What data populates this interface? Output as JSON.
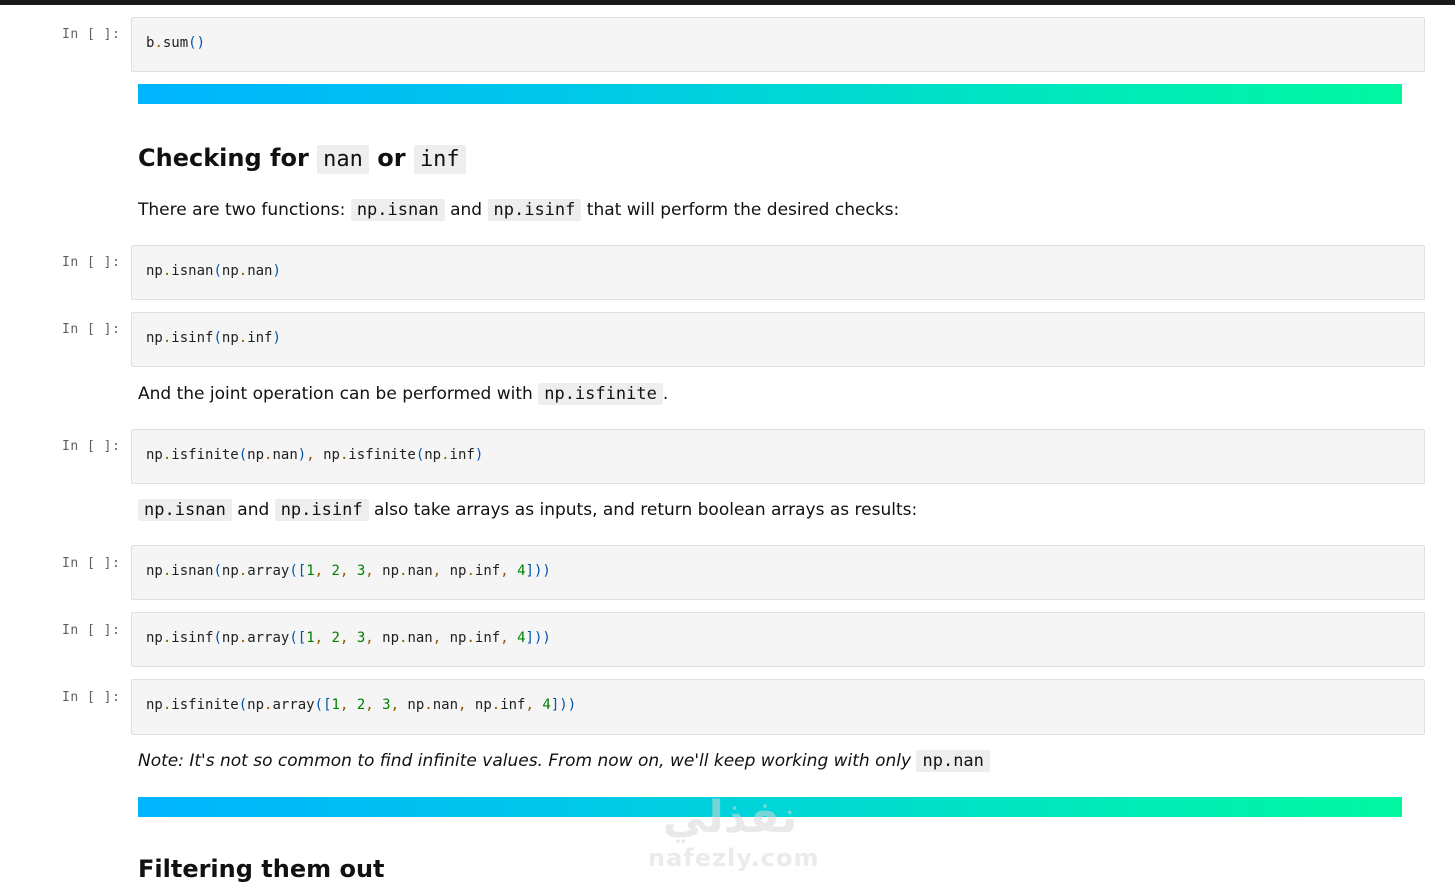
{
  "prompt_label": "In [ ]:",
  "cells": [
    {
      "code": "b.sum()"
    },
    {
      "code": "np.isnan(np.nan)"
    },
    {
      "code": "np.isinf(np.inf)"
    },
    {
      "code": "np.isfinite(np.nan), np.isfinite(np.inf)"
    },
    {
      "code": "np.isnan(np.array([1, 2, 3, np.nan, np.inf, 4]))"
    },
    {
      "code": "np.isinf(np.array([1, 2, 3, np.nan, np.inf, 4]))"
    },
    {
      "code": "np.isfinite(np.array([1, 2, 3, np.nan, np.inf, 4]))"
    }
  ],
  "section1": {
    "title_prefix": "Checking for ",
    "title_code1": "nan",
    "title_mid": " or ",
    "title_code2": "inf"
  },
  "md1": {
    "prefix": "There are two functions: ",
    "code1": "np.isnan",
    "mid": " and ",
    "code2": "np.isinf",
    "suffix": " that will perform the desired checks:"
  },
  "md2": {
    "prefix": "And the joint operation can be performed with ",
    "code1": "np.isfinite",
    "suffix": "."
  },
  "md3": {
    "code1": "np.isnan",
    "mid": " and ",
    "code2": "np.isinf",
    "suffix": " also take arrays as inputs, and return boolean arrays as results:"
  },
  "md4": {
    "prefix": "Note: It's not so common to find infinite values. From now on, we'll keep working with only ",
    "code1": "np.nan"
  },
  "section2": {
    "title": "Filtering them out"
  },
  "watermark": {
    "arabic": "نفذلي",
    "text": "nafezly.com"
  },
  "colors": {
    "bar_start": "#00b4ff",
    "bar_end": "#00f7a0",
    "cell_bg": "#f5f5f5",
    "prompt": "#616161"
  }
}
